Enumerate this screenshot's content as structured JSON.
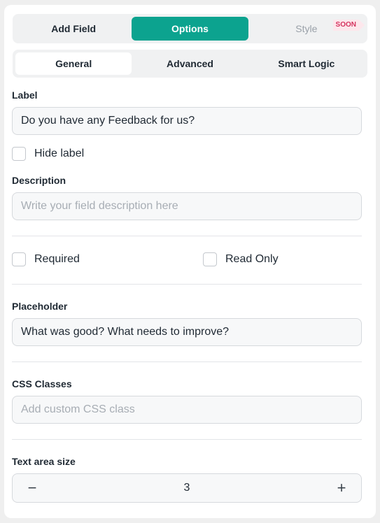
{
  "top_tabs": {
    "add_field": "Add Field",
    "options": "Options",
    "style": "Style",
    "style_badge": "SOON"
  },
  "sub_tabs": {
    "general": "General",
    "advanced": "Advanced",
    "smart_logic": "Smart Logic"
  },
  "label_field": {
    "label": "Label",
    "value": "Do you have any Feedback for us?"
  },
  "hide_label": {
    "label": "Hide label",
    "checked": false
  },
  "description_field": {
    "label": "Description",
    "placeholder": "Write your field description here"
  },
  "required": {
    "label": "Required",
    "checked": false
  },
  "read_only": {
    "label": "Read Only",
    "checked": false
  },
  "placeholder_field": {
    "label": "Placeholder",
    "value": "What was good? What needs to improve?"
  },
  "css_classes_field": {
    "label": "CSS Classes",
    "placeholder": "Add custom CSS class"
  },
  "text_area_size": {
    "label": "Text area size",
    "value": "3",
    "decrement": "−",
    "increment": "+"
  },
  "colors": {
    "accent": "#0ca38f",
    "badge_text": "#d5335f",
    "badge_bg": "#fde7ec"
  }
}
